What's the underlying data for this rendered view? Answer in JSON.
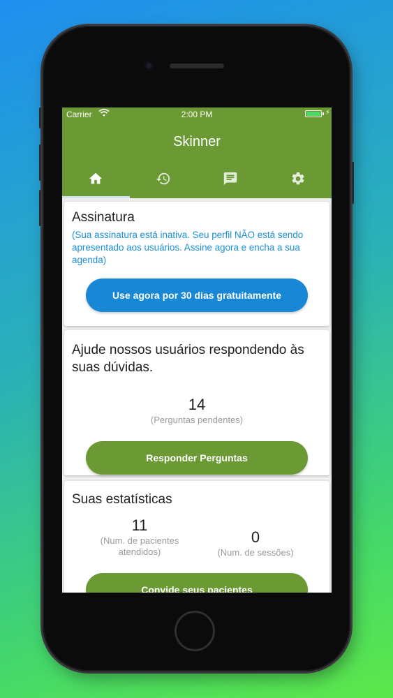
{
  "status": {
    "carrier": "Carrier",
    "time": "2:00 PM"
  },
  "app": {
    "title": "Skinner"
  },
  "tabs": [
    {
      "icon": "home-icon",
      "active": true
    },
    {
      "icon": "history-icon",
      "active": false
    },
    {
      "icon": "chat-icon",
      "active": false
    },
    {
      "icon": "gear-icon",
      "active": false
    }
  ],
  "subscription": {
    "title": "Assinatura",
    "note": "(Sua assinatura está inativa. Seu perfil NÃO está sendo apresentado aos usuários. Assine agora e encha a sua agenda)",
    "button": "Use agora por 30 dias gratuitamente"
  },
  "questions": {
    "title": "Ajude nossos usuários respondendo às suas dúvidas.",
    "count": "14",
    "count_label": "(Perguntas pendentes)",
    "button": "Responder Perguntas"
  },
  "stats": {
    "title": "Suas estatísticas",
    "patients_count": "11",
    "patients_label": "(Num. de pacientes atendidos)",
    "sessions_count": "0",
    "sessions_label": "(Num. de sessões)",
    "button": "Convide seus pacientes"
  },
  "colors": {
    "brand_green": "#6b9a34",
    "accent_blue": "#1888d6",
    "note_blue": "#1b8fd6"
  }
}
